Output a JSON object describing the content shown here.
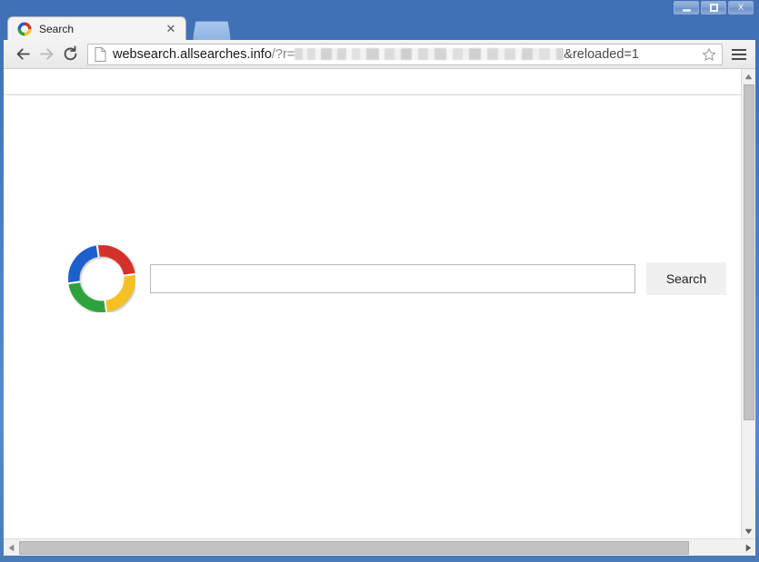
{
  "window": {
    "frame_color": "#4a7ab8",
    "controls": [
      {
        "name": "minimize",
        "label": "–",
        "icon": "minimize-icon"
      },
      {
        "name": "maximize",
        "label": "❐",
        "icon": "maximize-icon"
      },
      {
        "name": "close",
        "label": "X",
        "icon": "close-icon"
      }
    ]
  },
  "tabstrip": {
    "tabs": [
      {
        "title": "Search",
        "favicon": "colored-ring-icon",
        "close_label": "✕"
      }
    ],
    "new_tab_label": ""
  },
  "toolbar": {
    "back_icon": "back-arrow-icon",
    "forward_icon": "forward-arrow-icon",
    "reload_icon": "reload-icon",
    "page_icon": "document-icon",
    "star_icon": "star-icon",
    "menu_icon": "hamburger-menu-icon",
    "url": {
      "host": "websearch.allsearches.info",
      "path": "/?r=",
      "redacted": "",
      "tail": "&reloaded=1",
      "full": "websearch.allsearches.info/?r=████████████████&reloaded=1"
    }
  },
  "page": {
    "logo": "colored-ring-logo",
    "logo_colors": {
      "blue": "#1f5fcd",
      "red": "#d3322a",
      "yellow": "#f4c020",
      "green": "#2da23c"
    },
    "search": {
      "value": "",
      "placeholder": "",
      "button_label": "Search"
    }
  },
  "scrollbars": {
    "vertical": {
      "up_arrow": "▲",
      "down_arrow": "▼"
    },
    "horizontal": {
      "left_arrow": "◀",
      "right_arrow": "▶"
    }
  }
}
